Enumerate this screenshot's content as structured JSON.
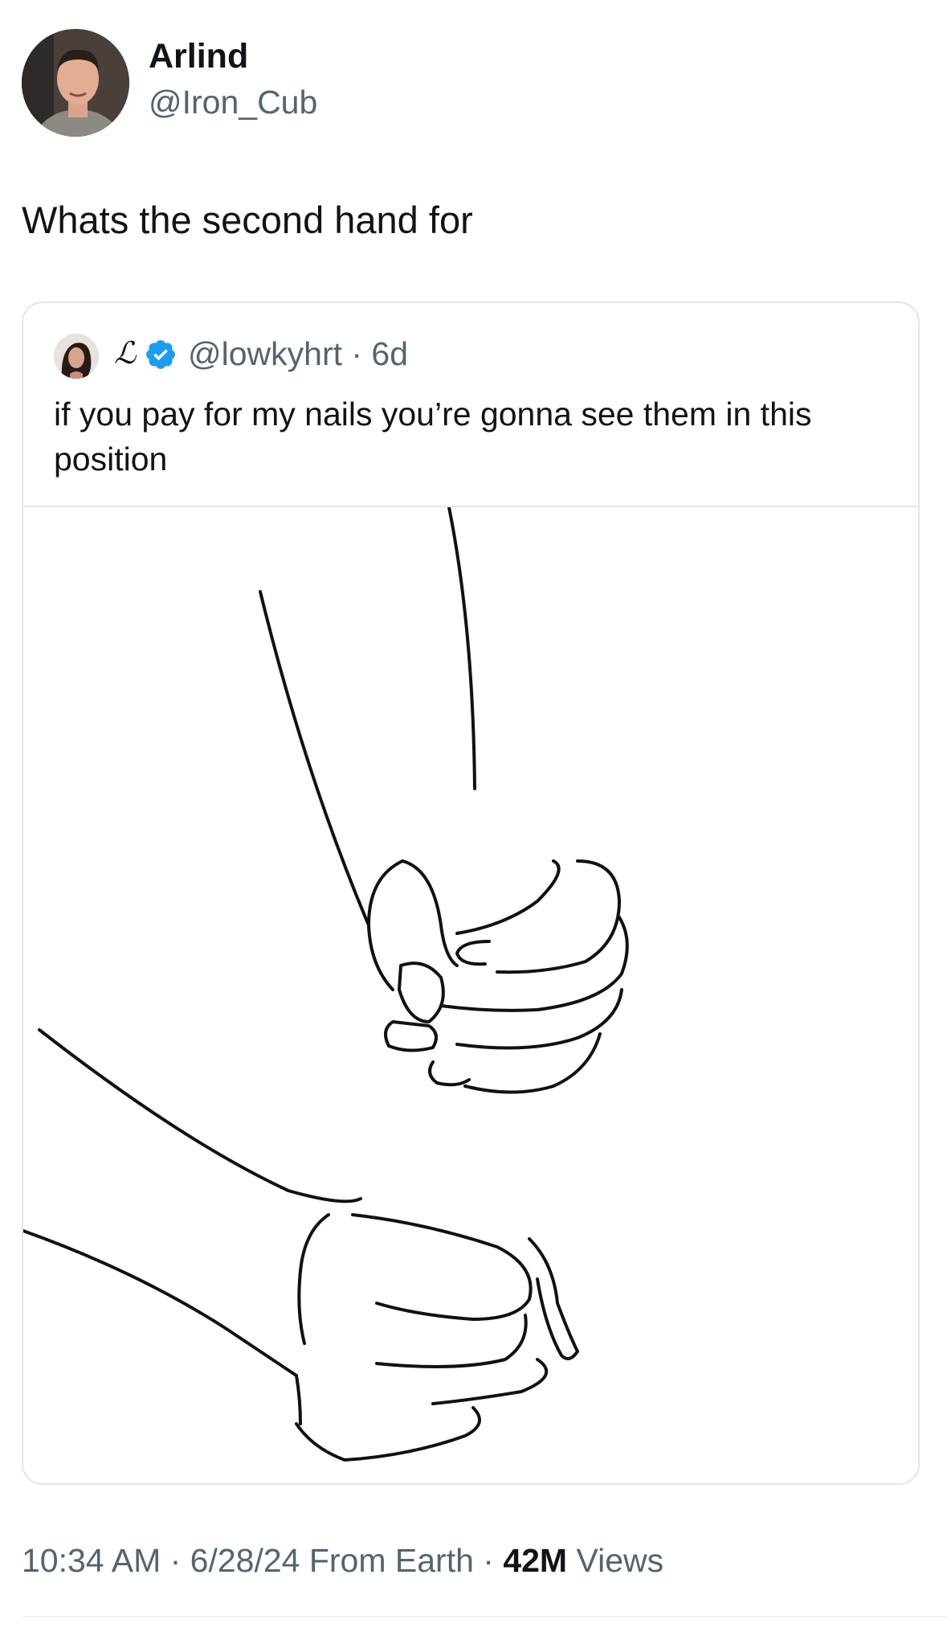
{
  "author": {
    "display_name": "Arlind",
    "handle": "@Iron_Cub",
    "avatar_icon": "profile-photo"
  },
  "tweet": {
    "text": "Whats the second hand for"
  },
  "quoted": {
    "name": "ℒ",
    "verified_icon": "verified-badge-icon",
    "handle_time": "@lowkyhrt · 6d",
    "text": "if you pay for my nails you’re gonna see them in this position",
    "image_icon": "hands-line-drawing"
  },
  "meta": {
    "timestamp": "10:34 AM · 6/28/24 From Earth · ",
    "views_count": "42M",
    "views_label": " Views"
  },
  "colors": {
    "text_primary": "#0f1419",
    "text_secondary": "#536471",
    "border": "#e1e6ea",
    "verified_blue": "#1d9bf0"
  }
}
